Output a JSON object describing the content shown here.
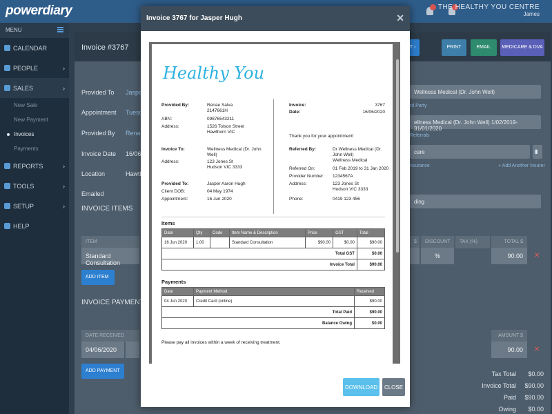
{
  "app": {
    "logo": "powerdiary",
    "centre": "THE HEALTHY YOU CENTRE",
    "user": "James"
  },
  "sidebar": {
    "menu_label": "MENU",
    "items": [
      {
        "label": "CALENDAR",
        "icon": "calendar-icon"
      },
      {
        "label": "PEOPLE",
        "icon": "person-icon"
      },
      {
        "label": "SALES",
        "icon": "money-icon"
      },
      {
        "label": "REPORTS",
        "icon": "chart-icon"
      },
      {
        "label": "TOOLS",
        "icon": "wrench-icon"
      },
      {
        "label": "SETUP",
        "icon": "gear-icon"
      },
      {
        "label": "HELP",
        "icon": "help-icon"
      }
    ],
    "sales_sub": [
      "New Sale",
      "New Payment",
      "Invoices",
      "Payments"
    ]
  },
  "invoice": {
    "title": "Invoice #3767",
    "buttons": {
      "print": "PRINT",
      "email": "EMAIL",
      "medicare": "MEDICARE & DVA",
      "next": "T"
    },
    "fields": [
      {
        "label": "Provided To",
        "value": "Jasper"
      },
      {
        "label": "Appointment",
        "value": "Tuesda"
      },
      {
        "label": "Provided By",
        "value": "Renae"
      },
      {
        "label": "Invoice Date",
        "value": "16/06/"
      },
      {
        "label": "Location",
        "value": "Hawth"
      },
      {
        "label": "Emailed",
        "value": ""
      }
    ],
    "right": {
      "provider": "Wellness Medical (Dr. John Well)",
      "third_party": "rd Party",
      "referral": "ellness Medical (Dr. John Well) 1/02/2019-31/01/2020",
      "referrals_link": "Referrals",
      "care": "care",
      "insurance_link": "nsurance",
      "add_insurer": "+ Add Another Insurer",
      "billing": "ding"
    },
    "items_title": "INVOICE ITEMS",
    "item_col": "ITEM",
    "item_row": "Standard Consultation",
    "discount_col": "DISCOUNT",
    "tax_col": "TAX (%)",
    "total_col": "TOTAL $",
    "s_col": "$",
    "item_total": "90.00",
    "pct": "%",
    "add_item": "ADD ITEM",
    "payments_title": "INVOICE PAYMENTS",
    "date_received_col": "DATE RECEIVED",
    "amount_col": "AMOUNT $",
    "payment_date": "04/06/2020",
    "payment_amount": "90.00",
    "add_payment": "ADD PAYMENT",
    "totals": [
      {
        "label": "Tax Total",
        "value": "$0.00"
      },
      {
        "label": "Invoice Total",
        "value": "$90.00"
      },
      {
        "label": "Paid",
        "value": "$90.00"
      },
      {
        "label": "Owing",
        "value": "$0.00"
      }
    ]
  },
  "modal": {
    "title": "Invoice 3767 for Jasper Hugh",
    "download": "DOWNLOAD",
    "close": "CLOSE",
    "doc": {
      "logo": "Healthy You",
      "provided_by_label": "Provided By:",
      "provided_by_name": "Renae Salva",
      "provided_by_num": "2147661H",
      "abn_label": "ABN:",
      "abn": "09876543211",
      "address_label": "Address:",
      "provider_address1": "1526 Tolson Street",
      "provider_address2": "Hawthorn VIC",
      "invoice_label": "Invoice:",
      "invoice_no": "3767",
      "date_label": "Date:",
      "date": "16/06/2020",
      "thanks": "Thank you for your appointment!",
      "invoice_to_label": "Invoice To:",
      "invoice_to1": "Wellness Medical (Dr. John",
      "invoice_to2": "Well)",
      "to_address1": "123 Jones St",
      "to_address2": "Hudson VIC 3333",
      "referred_by_label": "Referred By:",
      "referred_by1": "Dr Wellness Medical (Dr.",
      "referred_by2": "John Well)",
      "referred_by3": "Wellness Medical",
      "referred_on_label": "Referred On:",
      "referred_on": "01 Feb 2019 to 31 Jan 2020",
      "provider_no_label": "Provider Number:",
      "provider_no": "1234567A",
      "ref_address1": "123 Jones St",
      "ref_address2": "Hudson VIC 3333",
      "phone_label": "Phone:",
      "phone": "0419 123 456",
      "provided_to_label": "Provided To:",
      "provided_to": "Jasper Aaron Hugh",
      "dob_label": "Client DOB:",
      "dob": "04 May 1974",
      "appt_label": "Appointment:",
      "appt": "16 Jun 2020",
      "items_heading": "Items",
      "items_cols": [
        "Date",
        "Qty",
        "Code",
        "Item Name & Description",
        "Price",
        "GST",
        "Total"
      ],
      "items_row": [
        "16 Jun 2020",
        "1.00",
        "",
        "Standard Consultation",
        "$90.00",
        "$0.00",
        "$90.00"
      ],
      "total_gst_label": "Total GST",
      "total_gst": "$0.00",
      "invoice_total_label": "Invoice Total",
      "invoice_total": "$90.00",
      "payments_heading": "Payments",
      "pay_cols": [
        "Date",
        "Payment Method",
        "Received"
      ],
      "pay_row": [
        "04 Jun 2020",
        "Credit Card (online)",
        "$90.00"
      ],
      "total_paid_label": "Total Paid",
      "total_paid": "$90.00",
      "balance_label": "Balance Owing",
      "balance": "$0.00",
      "footnote": "Please pay all invoices within a week of receiving treatment."
    }
  }
}
